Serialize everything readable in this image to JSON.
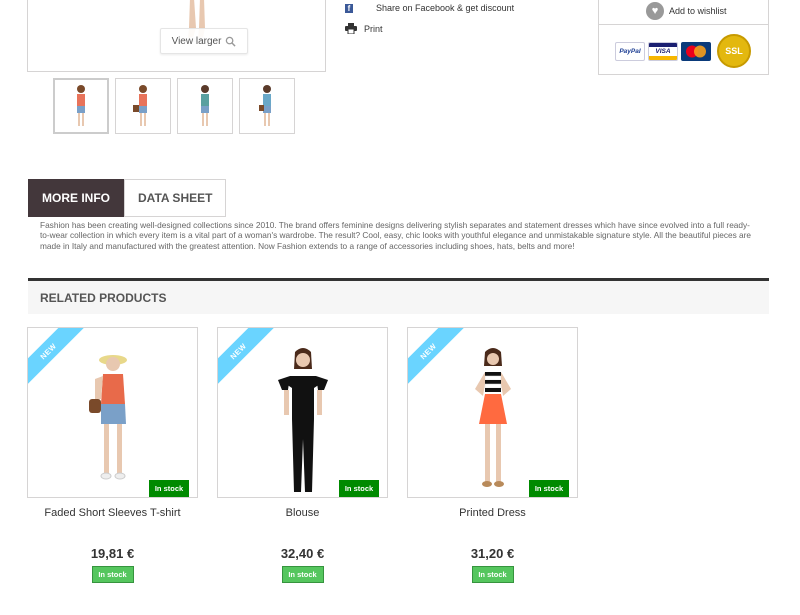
{
  "gallery": {
    "view_larger_label": "View larger",
    "thumbnails": [
      "thumb-1",
      "thumb-2",
      "thumb-3",
      "thumb-4"
    ]
  },
  "share": {
    "facebook_label": "Share on Facebook & get discount",
    "print_label": "Print"
  },
  "buybox": {
    "wishlist_label": "Add to wishlist",
    "payment_logos": [
      "PayPal",
      "VISA",
      "MasterCard",
      "SSL"
    ]
  },
  "tabs": {
    "items": [
      {
        "label": "More info",
        "active": true
      },
      {
        "label": "Data sheet",
        "active": false
      }
    ],
    "content": "Fashion has been creating well-designed collections since 2010. The brand offers feminine designs delivering stylish separates and statement dresses which have since evolved into a full ready-to-wear collection in which every item is a vital part of a woman's wardrobe. The result? Cool, easy, chic looks with youthful elegance and unmistakable signature style. All the beautiful pieces are made in Italy and manufactured with the greatest attention. Now Fashion extends to a range of accessories including shoes, hats, belts and more!"
  },
  "related": {
    "title": "Related products",
    "products": [
      {
        "ribbon": "New",
        "name": "Faded Short Sleeves T-shirt",
        "price": "19,81 €",
        "stock_badge": "In stock",
        "stock_button": "In stock"
      },
      {
        "ribbon": "New",
        "name": "Blouse",
        "price": "32,40 €",
        "stock_badge": "In stock",
        "stock_button": "In stock"
      },
      {
        "ribbon": "New",
        "name": "Printed Dress",
        "price": "31,20 €",
        "stock_badge": "In stock",
        "stock_button": "In stock"
      }
    ]
  },
  "colors": {
    "tab_active": "#43373b",
    "new_ribbon": "#6ad4ff",
    "in_stock_badge": "#008a00",
    "in_stock_button": "#55c65e"
  }
}
